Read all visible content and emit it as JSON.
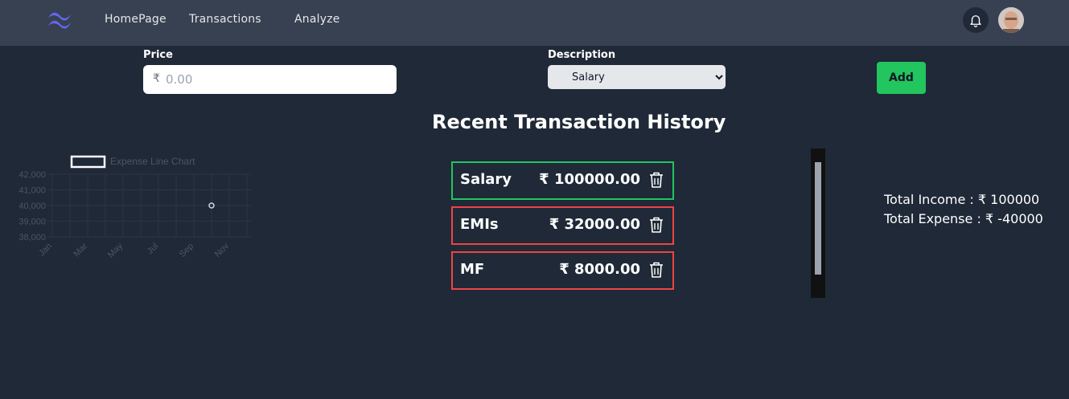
{
  "nav": {
    "links": [
      "HomePage",
      "Transactions",
      "Analyze"
    ]
  },
  "form": {
    "price_label": "Price",
    "currency_symbol": "₹",
    "price_placeholder": "0.00",
    "description_label": "Description",
    "description_selected": "Salary",
    "add_label": "Add"
  },
  "history": {
    "title": "Recent Transaction History",
    "items": [
      {
        "name": "Salary",
        "amount": "₹ 100000.00",
        "kind": "income",
        "color": "#22c55e"
      },
      {
        "name": "EMIs",
        "amount": "₹ 32000.00",
        "kind": "expense",
        "color": "#ef4444"
      },
      {
        "name": "MF",
        "amount": "₹ 8000.00",
        "kind": "expense",
        "color": "#ef4444"
      }
    ]
  },
  "totals": {
    "income": "Total Income : ₹ 100000",
    "expense": "Total Expense : ₹ -40000"
  },
  "chart_data": {
    "type": "line",
    "legend": "Expense Line Chart",
    "x_ticks": [
      "Jan",
      "Mar",
      "May",
      "Jul",
      "Sep",
      "Nov"
    ],
    "y_ticks": [
      "42,000",
      "41,000",
      "40,000",
      "39,000",
      "38,000"
    ],
    "ylim": [
      38000,
      42000
    ],
    "series": [
      {
        "name": "Expense Line Chart",
        "points": [
          {
            "x": "Oct",
            "y": 40000
          }
        ]
      }
    ],
    "grid": true
  },
  "colors": {
    "bg": "#1f2937",
    "navbar": "#374151",
    "income": "#22c55e",
    "expense": "#ef4444"
  }
}
